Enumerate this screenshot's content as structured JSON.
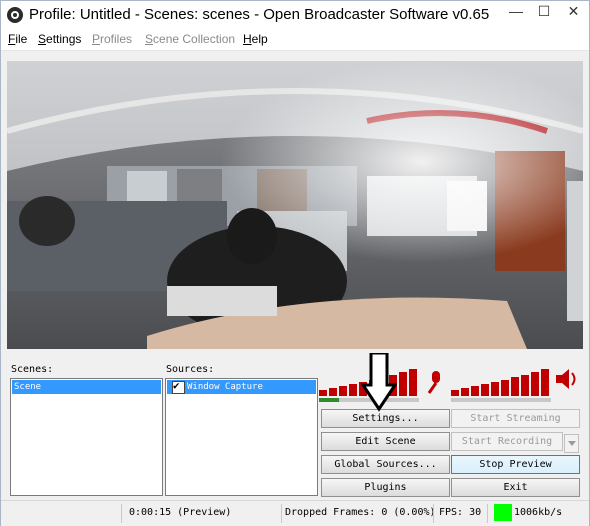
{
  "window": {
    "title": "Profile: Untitled - Scenes: scenes - Open Broadcaster Software v0.65",
    "controls": {
      "minimize": "—",
      "maximize": "☐",
      "close": "✕"
    }
  },
  "menu": {
    "items": [
      {
        "label": "File",
        "enabled": true
      },
      {
        "label": "Settings",
        "enabled": true
      },
      {
        "label": "Profiles",
        "enabled": false
      },
      {
        "label": "Scene Collection",
        "enabled": false
      },
      {
        "label": "Help",
        "enabled": true
      }
    ]
  },
  "preview": {
    "description_icon": "panorama-preview"
  },
  "scenes": {
    "label": "Scenes:",
    "items": [
      "Scene"
    ]
  },
  "sources": {
    "label": "Sources:",
    "items": [
      {
        "label": "Window Capture",
        "checked": true
      }
    ]
  },
  "audio": {
    "mic_icon": "microphone-icon",
    "speaker_icon": "speaker-icon",
    "mic_level": 0.85,
    "desktop_level": 0.85
  },
  "buttons": {
    "settings": "Settings...",
    "start_streaming": "Start Streaming",
    "edit_scene": "Edit Scene",
    "start_recording": "Start Recording",
    "global_sources": "Global Sources...",
    "stop_preview": "Stop Preview",
    "plugins": "Plugins",
    "exit": "Exit"
  },
  "status": {
    "time": "0:00:15 (Preview)",
    "dropped_frames": "Dropped Frames: 0 (0.00%)",
    "fps": "FPS: 30",
    "bitrate": "1006kb/s",
    "bitrate_color": "#00ff00"
  },
  "colors": {
    "meter_red": "#c00000",
    "meter_green": "#2e8b2e",
    "selection": "#3399ff"
  }
}
